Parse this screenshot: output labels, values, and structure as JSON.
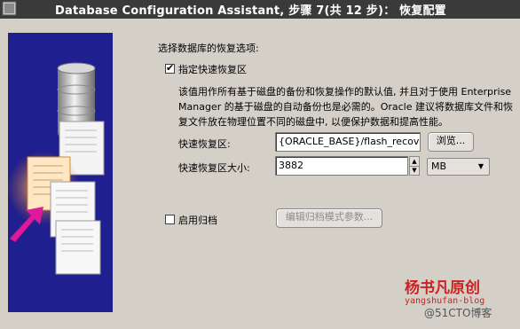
{
  "window": {
    "title": "Database Configuration Assistant, 步骤 7(共 12 步)：  恢复配置",
    "icon": "dbca-app-icon"
  },
  "side_panel": {
    "illustration": "database-documents-illustration"
  },
  "recovery_group": {
    "label": "选择数据库的恢复选项:",
    "fra_checkbox": {
      "checked": true,
      "label": "指定快速恢复区"
    },
    "description": [
      "该值用作所有基于磁盘的备份和恢复操作的默认值, 并且对于使用 Enterprise",
      "Manager 的基于磁盘的自动备份也是必需的。Oracle 建议将数据库文件和恢",
      "复文件放在物理位置不同的磁盘中, 以便保护数据和提高性能。"
    ],
    "fra_location": {
      "label": "快速恢复区:",
      "value": "{ORACLE_BASE}/flash_recover",
      "browse_label": "浏览..."
    },
    "fra_size": {
      "label": "快速恢复区大小:",
      "value": "3882",
      "unit": "MB"
    }
  },
  "archive": {
    "checkbox": {
      "checked": false,
      "label": "启用归档"
    },
    "edit_params_label": "编辑归档模式参数..."
  },
  "watermark": {
    "line1": "杨书凡原创",
    "line2": "yangshufan-blog",
    "line3": "@51CTO博客"
  }
}
